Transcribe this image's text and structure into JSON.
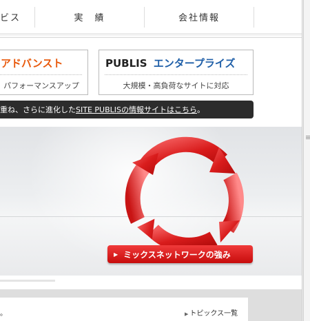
{
  "nav": {
    "items": [
      "ビス",
      "実　績",
      "会社情報"
    ]
  },
  "products": {
    "advanced": {
      "title": "アドバンスト",
      "subtitle": "パフォーマンスアップ",
      "color": "#e8590c"
    },
    "enterprise": {
      "title_brand": "PUBLIS",
      "title_rest": "エンタープライズ",
      "subtitle": "大規模・高負荷なサイトに対応",
      "brand_color": "#222222",
      "accent_color": "#1f5fa8"
    }
  },
  "infobar": {
    "prefix": "重ね、さらに進化した",
    "link": "SITE PUBLISの情報サイトはこちら",
    "suffix": "。"
  },
  "hero": {
    "button_label": "ミックスネットワークの強み",
    "icon": "circular-arrows-icon",
    "accent": "#d41a1a"
  },
  "footer": {
    "topics_link": "トピックス一覧",
    "left_char": "。"
  }
}
